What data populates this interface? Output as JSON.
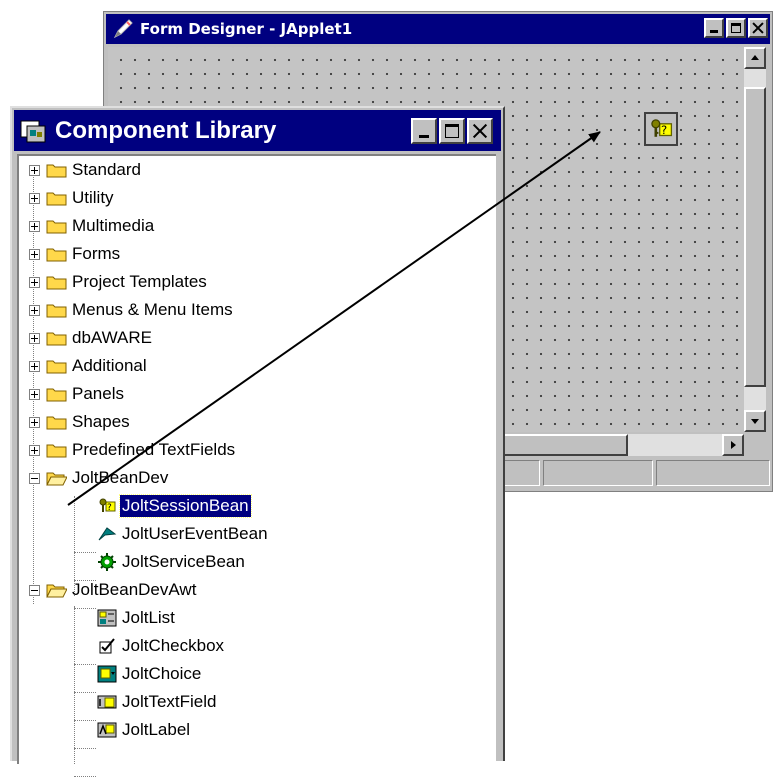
{
  "form_designer": {
    "title": "Form Designer - JApplet1"
  },
  "component_library": {
    "title": "Component Library",
    "tree": [
      {
        "label": "Standard",
        "expanded": false
      },
      {
        "label": "Utility",
        "expanded": false
      },
      {
        "label": "Multimedia",
        "expanded": false
      },
      {
        "label": "Forms",
        "expanded": false
      },
      {
        "label": "Project Templates",
        "expanded": false
      },
      {
        "label": "Menus & Menu Items",
        "expanded": false
      },
      {
        "label": "dbAWARE",
        "expanded": false
      },
      {
        "label": "Additional",
        "expanded": false
      },
      {
        "label": "Panels",
        "expanded": false
      },
      {
        "label": "Shapes",
        "expanded": false
      },
      {
        "label": "Predefined TextFields",
        "expanded": false
      },
      {
        "label": "JoltBeanDev",
        "expanded": true,
        "children": [
          {
            "label": "JoltSessionBean",
            "icon": "session-bean-icon",
            "selected": true
          },
          {
            "label": "JoltUserEventBean",
            "icon": "user-event-bean-icon"
          },
          {
            "label": "JoltServiceBean",
            "icon": "service-bean-icon"
          }
        ]
      },
      {
        "label": "JoltBeanDevAwt",
        "expanded": true,
        "children": [
          {
            "label": "JoltList",
            "icon": "list-icon"
          },
          {
            "label": "JoltCheckbox",
            "icon": "checkbox-icon"
          },
          {
            "label": "JoltChoice",
            "icon": "choice-icon"
          },
          {
            "label": "JoltTextField",
            "icon": "text-field-icon"
          },
          {
            "label": "JoltLabel",
            "icon": "label-icon"
          }
        ]
      }
    ]
  },
  "colors": {
    "titlebar": "#000080",
    "window_face": "#c0c0c0",
    "selection": "#000080",
    "folder": "#ffd84a"
  }
}
